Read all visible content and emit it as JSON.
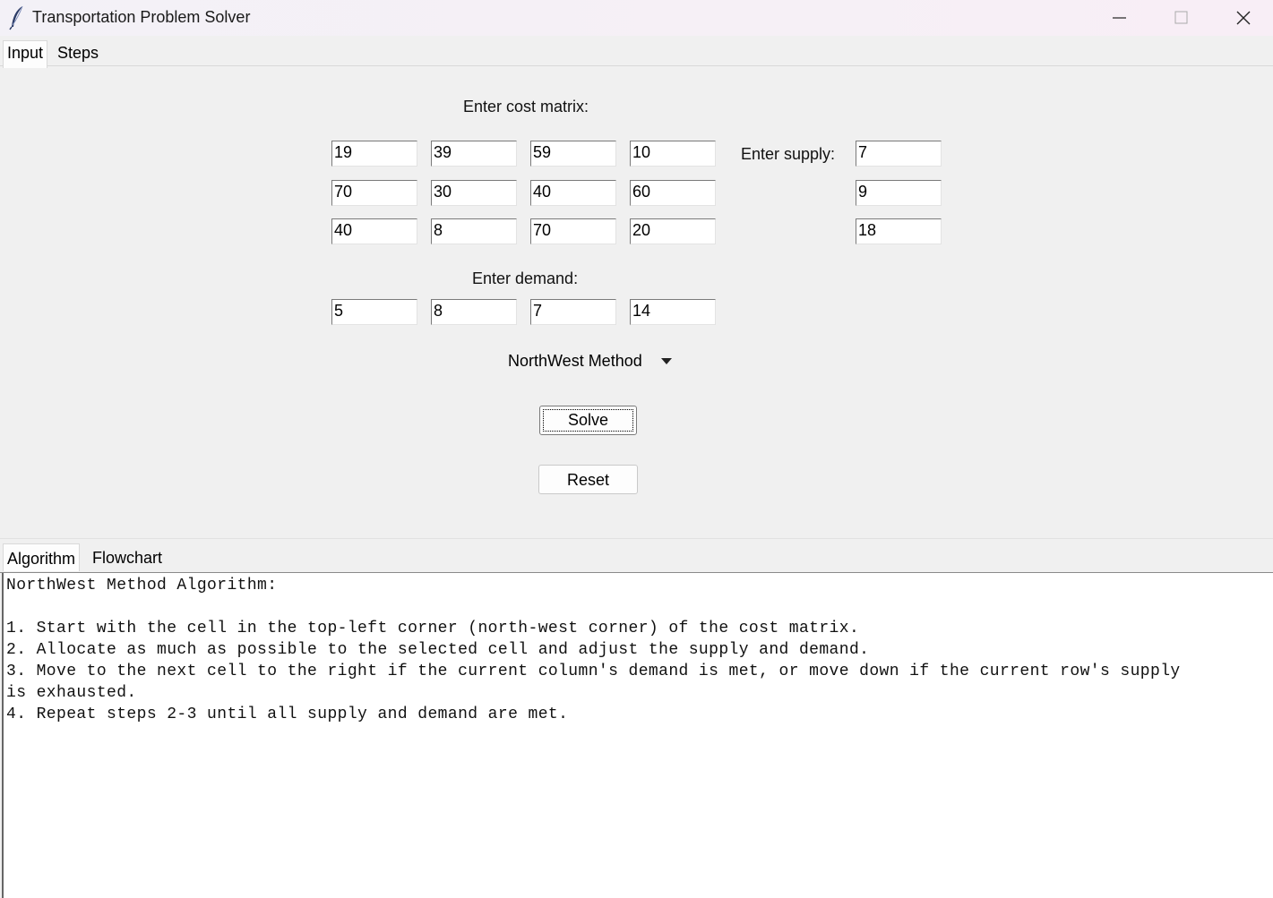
{
  "window": {
    "title": "Transportation Problem Solver",
    "icon": "feather-icon"
  },
  "top_tabs": [
    {
      "label": "Input",
      "active": true
    },
    {
      "label": "Steps",
      "active": false
    }
  ],
  "input": {
    "cost_label": "Enter cost matrix:",
    "cost_matrix": [
      [
        "19",
        "39",
        "59",
        "10"
      ],
      [
        "70",
        "30",
        "40",
        "60"
      ],
      [
        "40",
        "8",
        "70",
        "20"
      ]
    ],
    "supply_label": "Enter supply:",
    "supply": [
      "7",
      "9",
      "18"
    ],
    "demand_label": "Enter demand:",
    "demand": [
      "5",
      "8",
      "7",
      "14"
    ],
    "method": "NorthWest Method",
    "solve_label": "Solve",
    "reset_label": "Reset"
  },
  "bottom_tabs": [
    {
      "label": "Algorithm",
      "active": true
    },
    {
      "label": "Flowchart",
      "active": false
    }
  ],
  "algorithm_text": [
    "NorthWest Method Algorithm:",
    "",
    "1. Start with the cell in the top-left corner (north-west corner) of the cost matrix.",
    "2. Allocate as much as possible to the selected cell and adjust the supply and demand.",
    "3. Move to the next cell to the right if the current column's demand is met, or move down if the current row's supply",
    "is exhausted.",
    "4. Repeat steps 2-3 until all supply and demand are met."
  ]
}
